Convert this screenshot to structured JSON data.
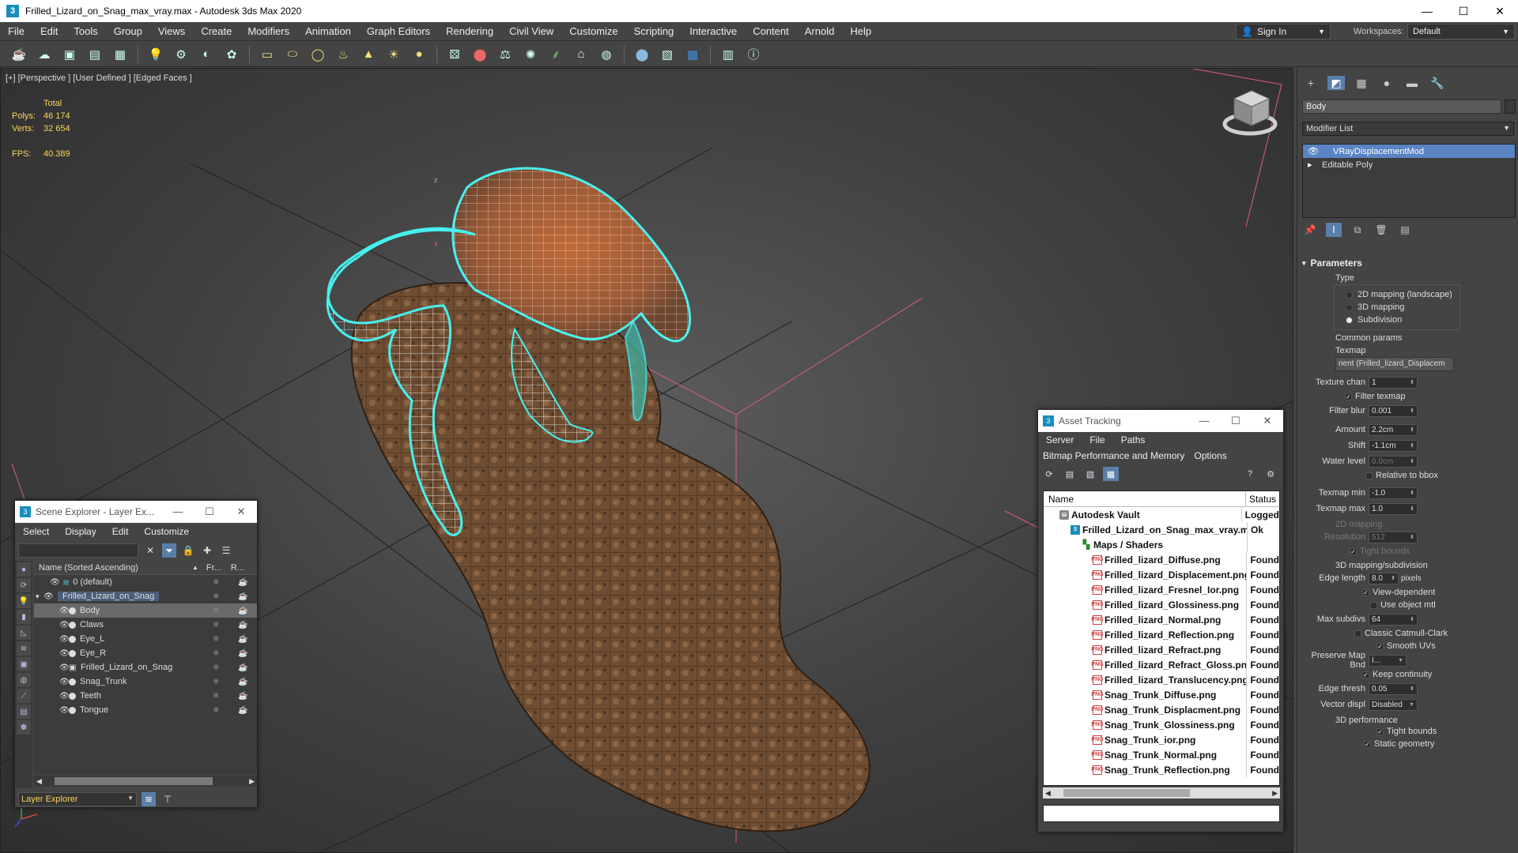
{
  "window": {
    "title": "Frilled_Lizard_on_Snag_max_vray.max - Autodesk 3ds Max 2020",
    "app_icon": "3",
    "min": "—",
    "max": "☐",
    "close": "✕"
  },
  "menu": [
    "File",
    "Edit",
    "Tools",
    "Group",
    "Views",
    "Create",
    "Modifiers",
    "Animation",
    "Graph Editors",
    "Rendering",
    "Civil View",
    "Customize",
    "Scripting",
    "Interactive",
    "Content",
    "Arnold",
    "Help"
  ],
  "signin": {
    "label": "Sign In"
  },
  "workspaces": {
    "label": "Workspaces:",
    "value": "Default"
  },
  "viewport": {
    "label": "[+] [Perspective ] [User Defined ] [Edged Faces ]",
    "stats": {
      "header": "Total",
      "polys_label": "Polys:",
      "polys": "46 174",
      "verts_label": "Verts:",
      "verts": "32 654",
      "fps_label": "FPS:",
      "fps": "40.389"
    }
  },
  "command_panel": {
    "object_name": "Body",
    "modifier_list": "Modifier List",
    "stack": [
      {
        "label": "VRayDisplacementMod",
        "selected": true
      },
      {
        "label": "Editable Poly",
        "selected": false
      }
    ],
    "parameters": {
      "title": "Parameters",
      "type_title": "Type",
      "types": [
        "2D mapping (landscape)",
        "3D mapping",
        "Subdivision"
      ],
      "common_title": "Common params",
      "texmap_label": "Texmap",
      "texmap_value": "nent (Frilled_lizard_Displacem",
      "texture_chan_label": "Texture chan",
      "texture_chan": "1",
      "filter_texmap": "Filter texmap",
      "filter_blur_label": "Filter blur",
      "filter_blur": "0.001",
      "amount_label": "Amount",
      "amount": "2.2cm",
      "shift_label": "Shift",
      "shift": "-1.1cm",
      "water_level_label": "Water level",
      "water_level": "0.0cm",
      "relative_bbox": "Relative to bbox",
      "texmap_min_label": "Texmap min",
      "texmap_min": "-1.0",
      "texmap_max_label": "Texmap max",
      "texmap_max": "1.0",
      "mapping2d_title": "2D mapping",
      "resolution_label": "Resolution",
      "resolution": "512",
      "tight_bounds": "Tight bounds",
      "mapping3d_title": "3D mapping/subdivision",
      "edge_length_label": "Edge length",
      "edge_length": "8.0",
      "edge_unit": "pixels",
      "view_dependent": "View-dependent",
      "use_object_mtl": "Use object mtl",
      "max_subdivs_label": "Max subdivs",
      "max_subdivs": "64",
      "classic_catmull": "Classic Catmull-Clark",
      "smooth_uvs": "Smooth UVs",
      "preserve_label": "Preserve Map Bnd",
      "preserve_value": "I...",
      "keep_continuity": "Keep continuity",
      "edge_thresh_label": "Edge thresh",
      "edge_thresh": "0.05",
      "vector_displ_label": "Vector displ",
      "vector_displ": "Disabled",
      "perf_title": "3D performance",
      "perf_tight": "Tight bounds",
      "perf_static": "Static geometry"
    }
  },
  "scene_explorer": {
    "title": "Scene Explorer - Layer Ex...",
    "menu": [
      "Select",
      "Display",
      "Edit",
      "Customize"
    ],
    "col_name": "Name (Sorted Ascending)",
    "col_fr": "Fr...",
    "col_r": "R...",
    "rows": [
      {
        "name": "0 (default)",
        "indent": 1,
        "kind": "layer"
      },
      {
        "name": "Frilled_Lizard_on_Snag",
        "indent": 0,
        "kind": "layer-active"
      },
      {
        "name": "Body",
        "indent": 2,
        "kind": "obj",
        "selected": true
      },
      {
        "name": "Claws",
        "indent": 2,
        "kind": "obj"
      },
      {
        "name": "Eye_L",
        "indent": 2,
        "kind": "obj"
      },
      {
        "name": "Eye_R",
        "indent": 2,
        "kind": "obj"
      },
      {
        "name": "Frilled_Lizard_on_Snag",
        "indent": 2,
        "kind": "group"
      },
      {
        "name": "Snag_Trunk",
        "indent": 2,
        "kind": "obj"
      },
      {
        "name": "Teeth",
        "indent": 2,
        "kind": "obj"
      },
      {
        "name": "Tongue",
        "indent": 2,
        "kind": "obj"
      }
    ],
    "layer_explorer": "Layer Explorer"
  },
  "asset_tracking": {
    "title": "Asset Tracking",
    "menu": [
      "Server",
      "File",
      "Paths"
    ],
    "menu2": [
      "Bitmap Performance and Memory",
      "Options"
    ],
    "col_name": "Name",
    "col_status": "Status",
    "rows": [
      {
        "name": "Autodesk Vault",
        "status": "Logged",
        "icon": "vault",
        "indent": 1
      },
      {
        "name": "Frilled_Lizard_on_Snag_max_vray.max",
        "status": "Ok",
        "icon": "max",
        "indent": 2
      },
      {
        "name": "Maps / Shaders",
        "status": "",
        "icon": "maps",
        "indent": 3
      },
      {
        "name": "Frilled_lizard_Diffuse.png",
        "status": "Found",
        "icon": "png",
        "indent": 4
      },
      {
        "name": "Frilled_lizard_Displacement.png",
        "status": "Found",
        "icon": "png",
        "indent": 4
      },
      {
        "name": "Frilled_lizard_Fresnel_Ior.png",
        "status": "Found",
        "icon": "png",
        "indent": 4
      },
      {
        "name": "Frilled_lizard_Glossiness.png",
        "status": "Found",
        "icon": "png",
        "indent": 4
      },
      {
        "name": "Frilled_lizard_Normal.png",
        "status": "Found",
        "icon": "png",
        "indent": 4
      },
      {
        "name": "Frilled_lizard_Reflection.png",
        "status": "Found",
        "icon": "png",
        "indent": 4
      },
      {
        "name": "Frilled_lizard_Refract.png",
        "status": "Found",
        "icon": "png",
        "indent": 4
      },
      {
        "name": "Frilled_lizard_Refract_Gloss.png",
        "status": "Found",
        "icon": "png",
        "indent": 4
      },
      {
        "name": "Frilled_lizard_Translucency.png",
        "status": "Found",
        "icon": "png",
        "indent": 4
      },
      {
        "name": "Snag_Trunk_Diffuse.png",
        "status": "Found",
        "icon": "png",
        "indent": 4
      },
      {
        "name": "Snag_Trunk_Displacment.png",
        "status": "Found",
        "icon": "png",
        "indent": 4
      },
      {
        "name": "Snag_Trunk_Glossiness.png",
        "status": "Found",
        "icon": "png",
        "indent": 4
      },
      {
        "name": "Snag_Trunk_ior.png",
        "status": "Found",
        "icon": "png",
        "indent": 4
      },
      {
        "name": "Snag_Trunk_Normal.png",
        "status": "Found",
        "icon": "png",
        "indent": 4
      },
      {
        "name": "Snag_Trunk_Reflection.png",
        "status": "Found",
        "icon": "png",
        "indent": 4
      }
    ]
  }
}
